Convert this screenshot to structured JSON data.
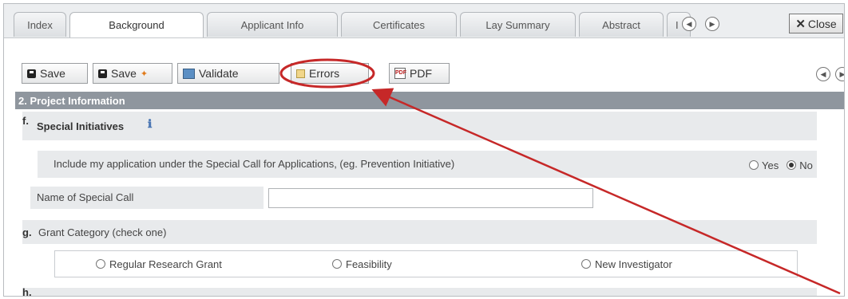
{
  "tabs": [
    {
      "label": "Index",
      "active": false
    },
    {
      "label": "Background",
      "active": true
    },
    {
      "label": "Applicant Info",
      "active": false
    },
    {
      "label": "Certificates",
      "active": false
    },
    {
      "label": "Lay Summary",
      "active": false
    },
    {
      "label": "Abstract",
      "active": false
    },
    {
      "label": "I",
      "active": false
    }
  ],
  "close_label": "Close",
  "toolbar": {
    "save_label": "Save",
    "save_plus_label": "Save",
    "validate_label": "Validate",
    "errors_label": "Errors",
    "pdf_label": "PDF"
  },
  "section": {
    "title": "2. Project Information",
    "f_letter": "f.",
    "f_title": "Special Initiatives",
    "special_call_question": "Include my application under the Special Call for Applications, (eg. Prevention Initiative)",
    "yes_label": "Yes",
    "no_label": "No",
    "selected": "No",
    "special_call_name_label": "Name of Special Call",
    "special_call_name_value": "",
    "g_letter": "g.",
    "g_title": "Grant Category (check one)",
    "grant_options": [
      "Regular Research Grant",
      "Feasibility",
      "New Investigator"
    ],
    "h_letter": "h."
  },
  "colors": {
    "annotation_red": "#c62828",
    "section_header_bg": "#8f969e",
    "row_shade": "#e8eaec"
  }
}
